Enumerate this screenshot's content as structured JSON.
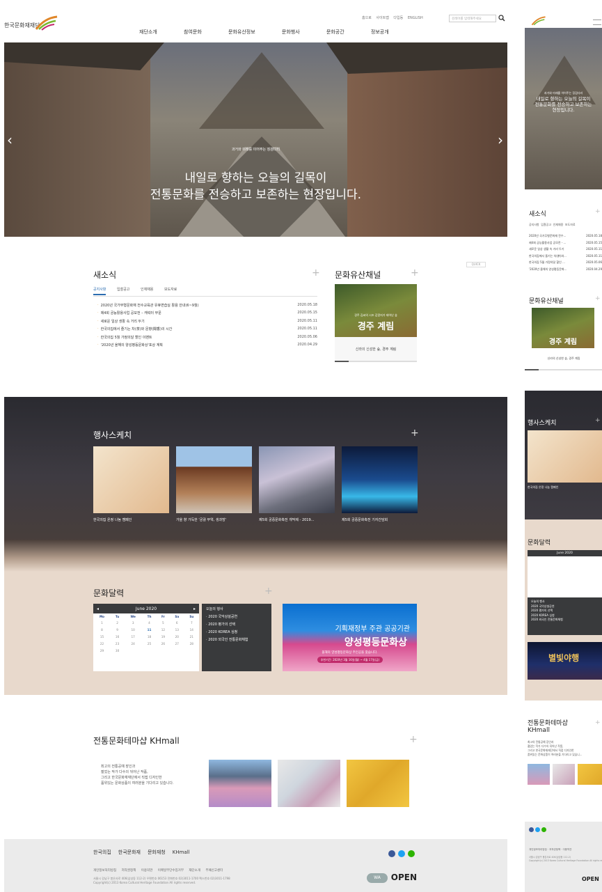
{
  "header": {
    "logo_text": "한국문화재재단",
    "util_links": [
      "홈으로",
      "사이트맵",
      "다입등",
      "ENGLISH"
    ],
    "search_placeholder": "검색어를 입력해주세요",
    "gnb": [
      "재단소개",
      "참여문화",
      "문화유산정보",
      "문화행사",
      "문화공간",
      "정보공개"
    ]
  },
  "hero": {
    "small": "과거와 미래를 이어주는 징검다리",
    "line1": "내일로 향하는 오늘의 길목이",
    "line2": "전통문화를 전승하고 보존하는 현장입니다.",
    "prev": "‹",
    "next": "›"
  },
  "news": {
    "title": "새소식",
    "plus": "+",
    "tabs": [
      "공지사항",
      "입찰공고",
      "인재채용",
      "보도자료"
    ],
    "items": [
      {
        "title": "2020년 국가무형문화재 전수교육관 유휴면습실 활용 안내(6~9월)",
        "date": "2020.05.18"
      },
      {
        "title": "제4회 궁능활용사업 공모전 – 캐릭터 부문",
        "date": "2020.05.15"
      },
      {
        "title": "새로운 일상 생활 속 거리 두기",
        "date": "2020.05.11"
      },
      {
        "title": "한국의집에서 즐기는 차(茶)와 문향(聞香)의 시간",
        "date": "2020.05.11"
      },
      {
        "title": "한국의집 5월 가정의달 할인 이벤트",
        "date": "2020.05.06"
      },
      {
        "title": "'2020년 올해의 양성평등문화상'포상 계획",
        "date": "2020.04.29"
      }
    ]
  },
  "channel": {
    "title": "문화유산채널",
    "plus": "+",
    "img_small": "경주 김씨의 시조 김알지가 태어난 숲",
    "img_big": "경주 계림",
    "caption": "신라의 신성한 숲, 경주 계림"
  },
  "quick_label": "QUICK",
  "events": {
    "title": "행사스케치",
    "plus": "+",
    "items": [
      {
        "caption": "한국의집 온정 나눔 캠페인",
        "color": "#e8c9a8"
      },
      {
        "caption": "가을 향 가득한 '궁궐 부엌, 생과방'",
        "color": "#8a5a3a"
      },
      {
        "caption": "제5회 궁중문화축전 개막제 - 2019...",
        "color": "#7a7f92"
      },
      {
        "caption": "제5회 궁중문화축전 기자간담회",
        "color": "#1e3a6a"
      }
    ]
  },
  "calendar": {
    "title": "문화달력",
    "plus": "+",
    "month": "June 2020",
    "weekdays": [
      "Mo",
      "Tu",
      "We",
      "Th",
      "Fr",
      "Sa",
      "Su"
    ],
    "weeks": [
      [
        "1",
        "2",
        "3",
        "4",
        "5",
        "6",
        "7"
      ],
      [
        "8",
        "9",
        "10",
        "11",
        "12",
        "13",
        "14"
      ],
      [
        "15",
        "16",
        "17",
        "18",
        "19",
        "20",
        "21"
      ],
      [
        "22",
        "23",
        "24",
        "25",
        "26",
        "27",
        "28"
      ],
      [
        "29",
        "30",
        "",
        "",
        "",
        "",
        ""
      ]
    ],
    "today_title": "오늘의 행사",
    "today_items": [
      "2020 국악상설공연",
      "2020 평가의 선택",
      "2020 KOREA 심청",
      "2020 외국인 전통문화체험"
    ]
  },
  "banner": {
    "line1": "기획재정부 주관 공공기관",
    "line2": "양성평등문화상",
    "line3": "올해의 양성평등문화상 주인공을 찾습니다.",
    "line4": "추천기간: 2020년 3월 16일(월) ~ 4월 17일(금)"
  },
  "mall": {
    "title": "전통문화테마샵 KHmall",
    "plus": "+",
    "lines": [
      "최고의 전통공예 장인과",
      "젊었는 작가 다수의 뒤어난 작품,",
      "그리고 한국문화재재단에서 직접 디자인한",
      "품위있는 문화상품이 여러분을 기다리고 있습니다."
    ]
  },
  "footer": {
    "logos": [
      "한국의집",
      "한국문화재",
      "문화재청",
      "KHmall"
    ],
    "links": [
      "개인정보처리방침",
      "저작권정책",
      "이용약관",
      "이메일무단수집거부",
      "재단소개",
      "부패신고센터"
    ],
    "addr1": "서울시 강남구 봉은사로 406(삼성동 112-2) 우편번호 06153 전화번호 02)3011-1700 팩스번호 02)3011-1798",
    "addr2": "Copyright(c) 2013 Korea Cultural Heritage Foundation All rights reserved.",
    "open": "OPEN",
    "wa": "WA"
  },
  "mobile": {
    "hero_small": "과거와 미래를 이어주는 징검다리",
    "hero_lines": [
      "내일로 향하는 오늘의 길목이",
      "전통문화를 전승하고 보존하는",
      "현장입니다."
    ],
    "news_title": "새소식",
    "news_tabs": [
      "공지사항",
      "입찰공고",
      "인재채용",
      "보도자료"
    ],
    "news_items": [
      {
        "title": "2020년 국가무형문화재 전수...",
        "date": "2020.05.18"
      },
      {
        "title": "제4회 궁능활용사업 공모전 - ...",
        "date": "2020.05.15"
      },
      {
        "title": "새로운 일상 생활 속 거리 두기",
        "date": "2020.05.11"
      },
      {
        "title": "한국의집에서 즐기는 차(茶)와...",
        "date": "2020.05.11"
      },
      {
        "title": "한국의집 5월 가정의달 할인 ...",
        "date": "2020.05.06"
      },
      {
        "title": "'2020년 올해의 양성평등문화...",
        "date": "2020.04.29"
      }
    ],
    "channel_title": "문화유산채널",
    "channel_big": "경주 계림",
    "channel_caption": "신라의 신성한 숲, 경주 계림",
    "events_title": "행사스케치",
    "events_caption": "한국의집 온정 나눔 캠페인",
    "cal_title": "문화달력",
    "cal_month": "June 2020",
    "today_title": "오늘의 행사",
    "today_items": [
      "2020 국악상설공연",
      "2020 평가의 선택",
      "2020 KOREA 심청",
      "2020 외국인 전통문화체험"
    ],
    "banner_text": "별빛야행",
    "mall_title_1": "전통문화테마샵",
    "mall_title_2": "KHmall",
    "mall_lines": [
      "최고의 전통공예 장인과",
      "젊었는 작가 다수의 뒤어난 작품,",
      "그리고 한국문화재재단에서 직접 디자인한",
      "품위있는 문화상품이 여러분을 기다리고 있습니..."
    ],
    "open": "OPEN",
    "footer_links": "개인정보처리방침 · 저작권정책 · 이용약관",
    "footer_addr": "서울시 강남구 봉은사로 406(삼성동 112-2)",
    "footer_copy": "Copyright(c) 2013 Korea Cultural Heritage Foundation All rights reserved."
  }
}
